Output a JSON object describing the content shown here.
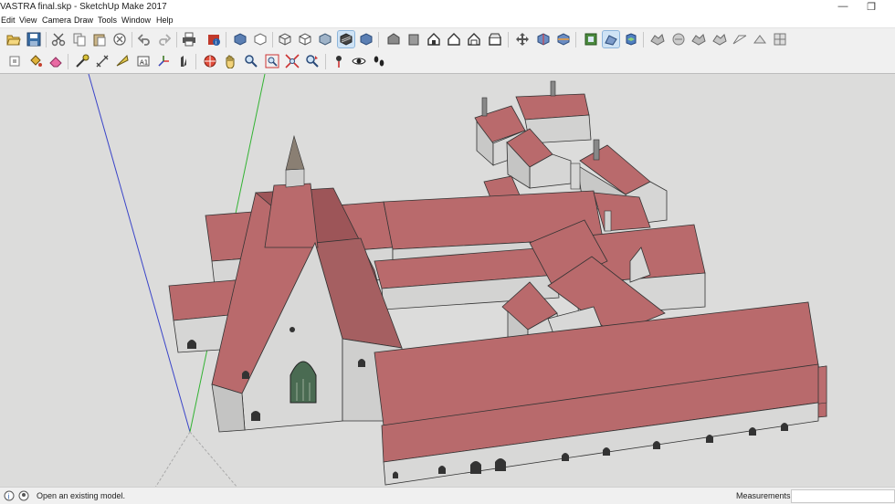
{
  "window": {
    "title": "VASTRA final.skp - SketchUp Make 2017",
    "minimize": "—",
    "maximize": "❐"
  },
  "menu": [
    "Edit",
    "View",
    "Camera",
    "Draw",
    "Tools",
    "Window",
    "Help"
  ],
  "toolbar1": [
    "new-icon",
    "open-icon",
    "save-icon",
    "cut-icon",
    "copy-icon",
    "paste-icon",
    "erase-icon",
    "undo-icon",
    "redo-icon",
    "print-icon",
    "model-info-icon",
    "box-icon",
    "cube-icon",
    "wireframe-icon",
    "hidden-line-icon",
    "shaded-icon",
    "shaded-textures-icon",
    "monochrome-icon",
    "iso-icon",
    "top-icon",
    "front-icon",
    "right-icon",
    "back-icon",
    "left-icon",
    "section-plane-icon",
    "section-display-icon",
    "section-cut-icon",
    "warehouse-icon",
    "share-model-icon",
    "components-icon",
    "sandbox-1-icon",
    "sandbox-2-icon",
    "sandbox-3-icon",
    "sandbox-4-icon",
    "sandbox-5-icon",
    "sandbox-6-icon"
  ],
  "toolbar2": [
    "make-component-icon",
    "paint-bucket-icon",
    "eraser-icon",
    "tape-measure-icon",
    "dimension-icon",
    "protractor-icon",
    "text-icon",
    "axes-icon",
    "3d-text-icon",
    "orbit-icon",
    "pan-icon",
    "zoom-icon",
    "zoom-window-icon",
    "zoom-extents-icon",
    "previous-view-icon",
    "position-camera-icon",
    "look-around-icon",
    "walk-icon"
  ],
  "colors": {
    "roof": "#b96a6c",
    "roof_dark": "#9d5558",
    "wall": "#dcdcdb",
    "wall_shade": "#c2c2c1",
    "sky": "#dcdcdb"
  },
  "status": {
    "message": "Open an existing model.",
    "measurements_label": "Measurements"
  }
}
